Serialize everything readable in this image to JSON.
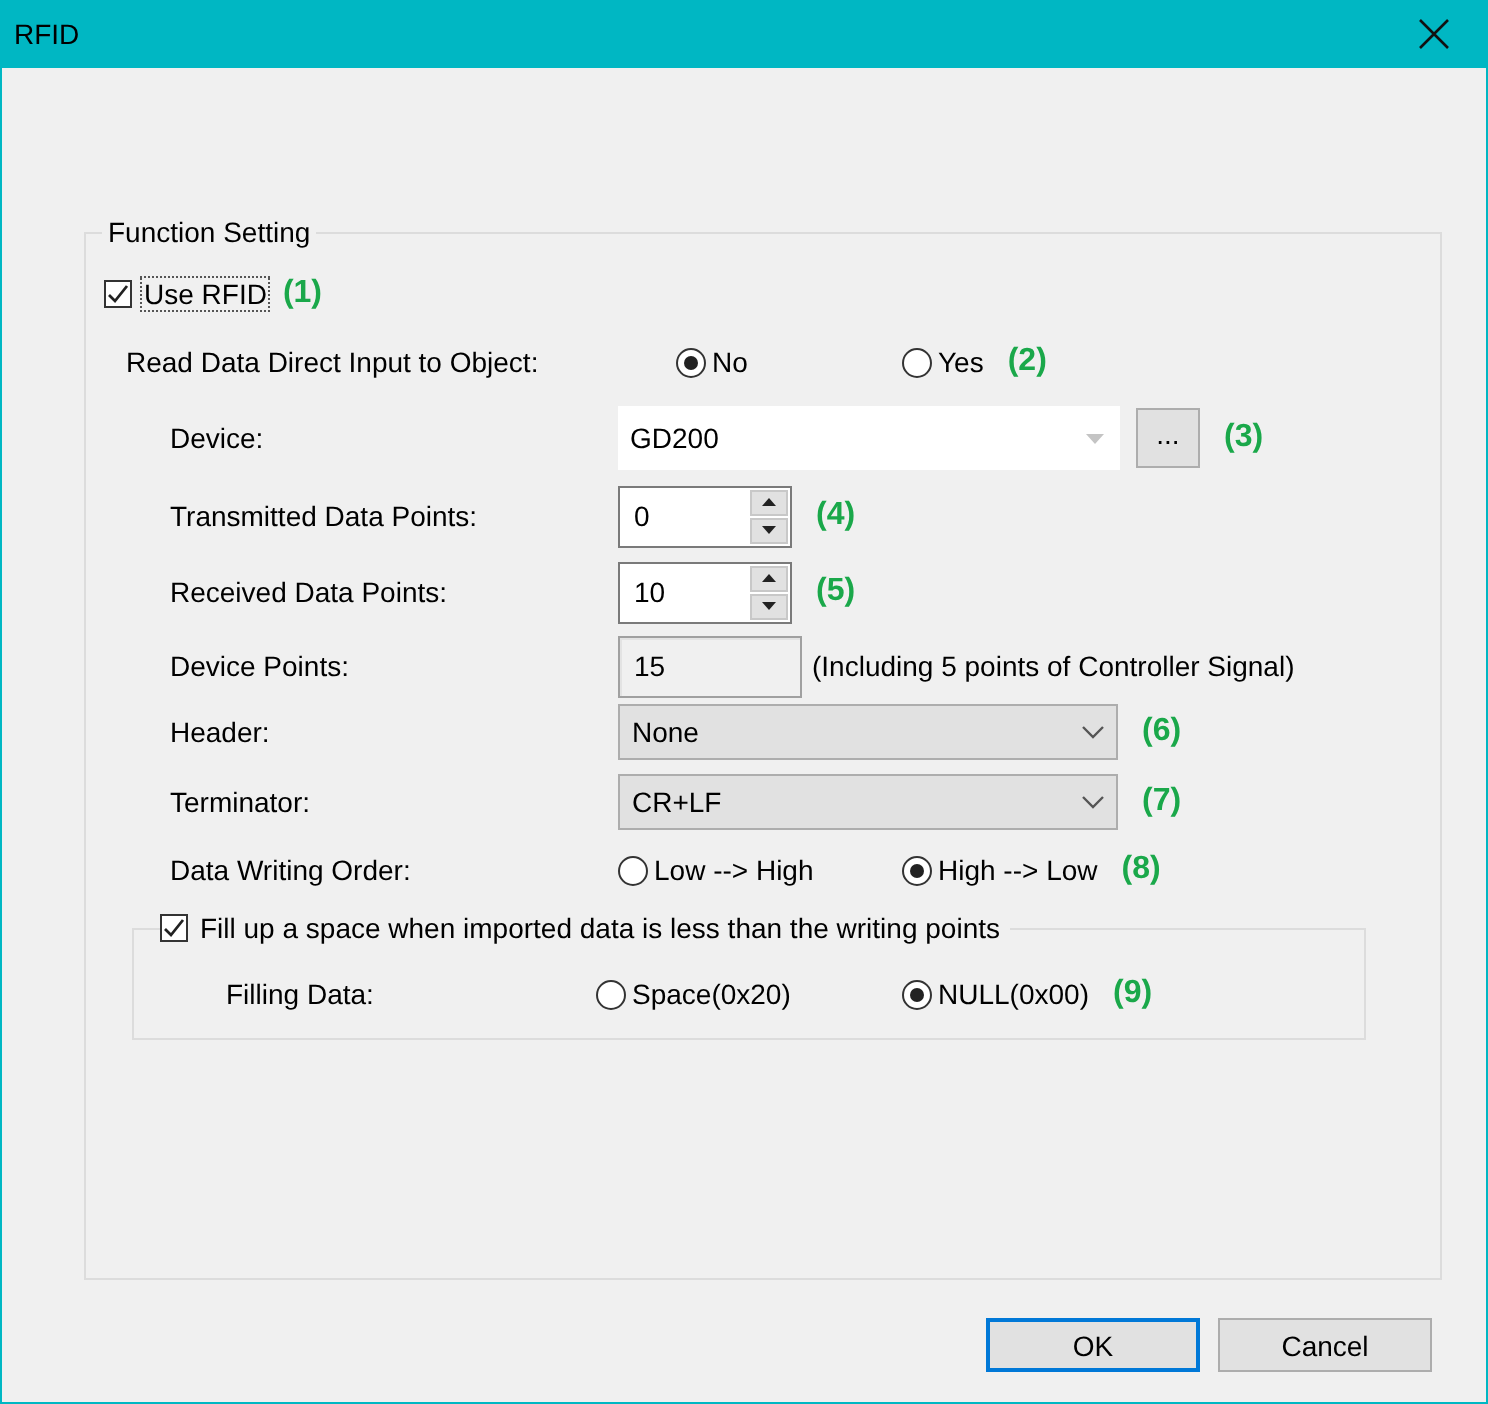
{
  "window": {
    "title": "RFID"
  },
  "group": {
    "title": "Function Setting"
  },
  "use_rfid": {
    "label": "Use RFID",
    "checked": true,
    "tag": "(1)"
  },
  "fields": [
    {
      "kind": "radio",
      "label": "Read Data Direct Input to Object:",
      "options": [
        {
          "label": "No",
          "selected": true
        },
        {
          "label": "Yes",
          "selected": false
        }
      ],
      "tag": "(2)"
    },
    {
      "kind": "combo",
      "label": "Device:",
      "value": "GD200",
      "button": "...",
      "tag": "(3)"
    },
    {
      "kind": "spin",
      "label": "Transmitted Data Points:",
      "value": "0",
      "tag": "(4)"
    },
    {
      "kind": "spin",
      "label": "Received Data Points:",
      "value": "10",
      "tag": "(5)"
    },
    {
      "kind": "readonly",
      "label": "Device Points:",
      "value": "15",
      "note": "(Including 5 points of Controller Signal)"
    },
    {
      "kind": "select",
      "label": "Header:",
      "value": "None",
      "tag": "(6)"
    },
    {
      "kind": "select",
      "label": "Terminator:",
      "value": "CR+LF",
      "tag": "(7)"
    },
    {
      "kind": "radio",
      "label": "Data Writing Order:",
      "options": [
        {
          "label": "Low --> High",
          "selected": false
        },
        {
          "label": "High --> Low",
          "selected": true
        }
      ],
      "tag": "(8)"
    }
  ],
  "fill_up": {
    "label": "Fill up a space when imported data is less than the writing points",
    "checked": true,
    "field": {
      "kind": "radio",
      "label": "Filling Data:",
      "options": [
        {
          "label": "Space(0x20)",
          "selected": false
        },
        {
          "label": "NULL(0x00)",
          "selected": true
        }
      ],
      "tag": "(9)"
    }
  },
  "buttons": [
    {
      "label": "OK",
      "default": true
    },
    {
      "label": "Cancel",
      "default": false
    }
  ]
}
